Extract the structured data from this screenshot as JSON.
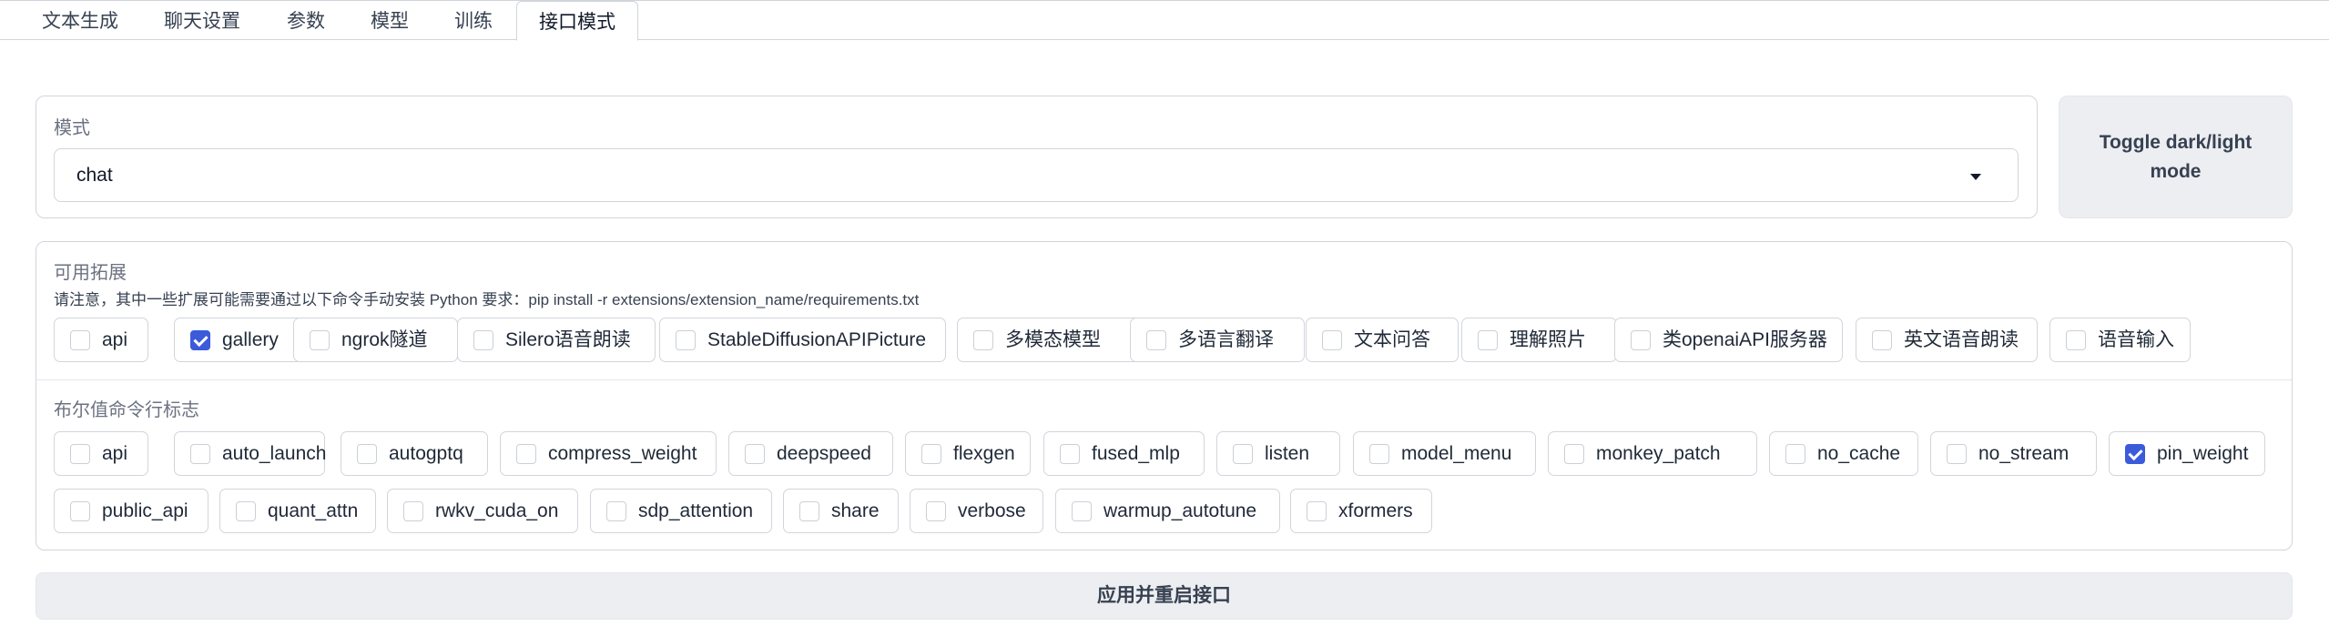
{
  "tabs": [
    "文本生成",
    "聊天设置",
    "参数",
    "模型",
    "训练",
    "接口模式"
  ],
  "active_tab": "接口模式",
  "mode": {
    "label": "模式",
    "value": "chat"
  },
  "toggle_label": "Toggle dark/light mode",
  "extensions": {
    "label": "可用拓展",
    "note": "请注意，其中一些扩展可能需要通过以下命令手动安装 Python 要求：pip install -r extensions/extension_name/requirements.txt",
    "items": [
      {
        "label": "api",
        "checked": false
      },
      {
        "label": "gallery",
        "checked": true
      },
      {
        "label": "ngrok隧道",
        "checked": false
      },
      {
        "label": "Silero语音朗读",
        "checked": false
      },
      {
        "label": "StableDiffusionAPIPicture",
        "checked": false
      },
      {
        "label": "多模态模型",
        "checked": false
      },
      {
        "label": "多语言翻译",
        "checked": false
      },
      {
        "label": "文本问答",
        "checked": false
      },
      {
        "label": "理解照片",
        "checked": false
      },
      {
        "label": "类openaiAPI服务器",
        "checked": false
      },
      {
        "label": "英文语音朗读",
        "checked": false
      },
      {
        "label": "语音输入",
        "checked": false
      }
    ]
  },
  "flags": {
    "label": "布尔值命令行标志",
    "items": [
      {
        "label": "api",
        "checked": false
      },
      {
        "label": "auto_launch",
        "checked": false
      },
      {
        "label": "autogptq",
        "checked": false
      },
      {
        "label": "compress_weight",
        "checked": false
      },
      {
        "label": "deepspeed",
        "checked": false
      },
      {
        "label": "flexgen",
        "checked": false
      },
      {
        "label": "fused_mlp",
        "checked": false
      },
      {
        "label": "listen",
        "checked": false
      },
      {
        "label": "model_menu",
        "checked": false
      },
      {
        "label": "monkey_patch",
        "checked": false
      },
      {
        "label": "no_cache",
        "checked": false
      },
      {
        "label": "no_stream",
        "checked": false
      },
      {
        "label": "pin_weight",
        "checked": true
      },
      {
        "label": "public_api",
        "checked": false
      },
      {
        "label": "quant_attn",
        "checked": false
      },
      {
        "label": "rwkv_cuda_on",
        "checked": false
      },
      {
        "label": "sdp_attention",
        "checked": false
      },
      {
        "label": "share",
        "checked": false
      },
      {
        "label": "verbose",
        "checked": false
      },
      {
        "label": "warmup_autotune",
        "checked": false
      },
      {
        "label": "xformers",
        "checked": false
      }
    ]
  },
  "apply_label": "应用并重启接口"
}
